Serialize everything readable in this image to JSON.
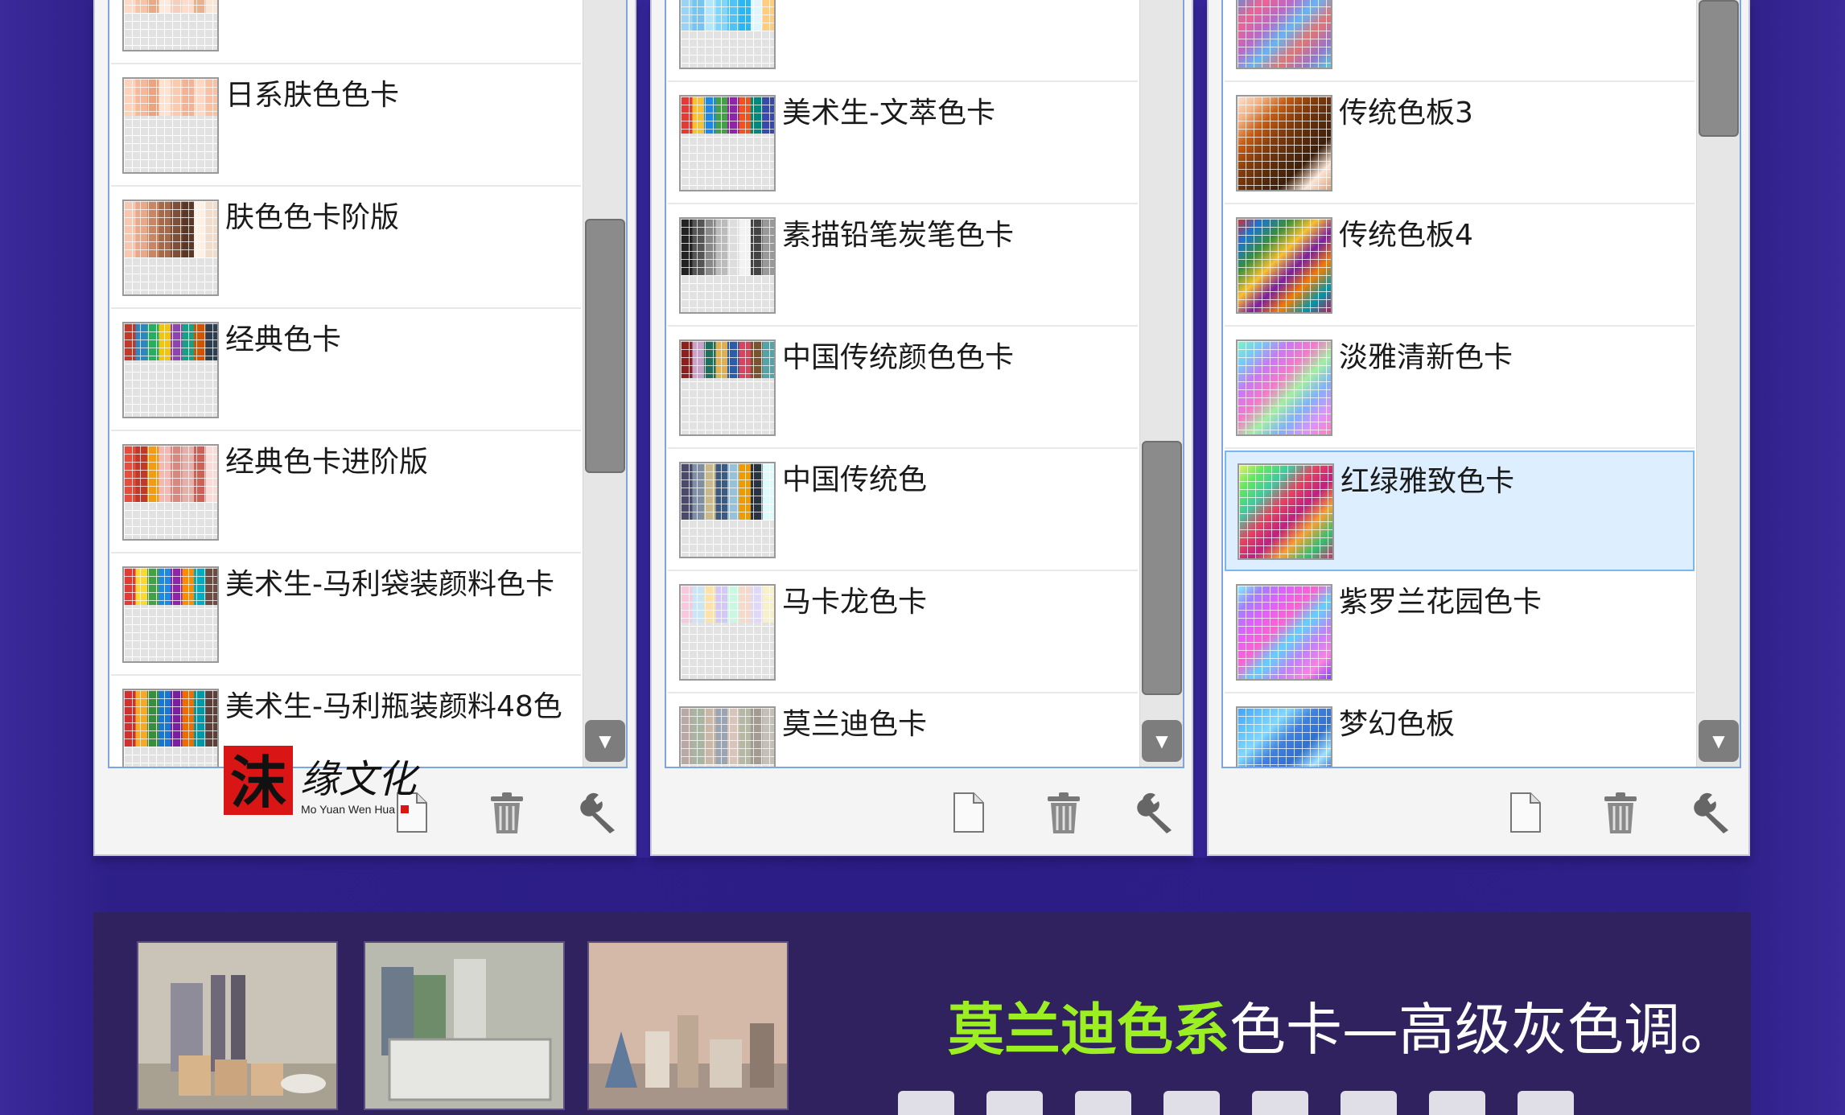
{
  "panels": [
    {
      "items": [
        {
          "label": "",
          "colors": [
            "#ffd9c8",
            "#f6c3a6",
            "#e9a983",
            "#ffe8dc",
            "#f5cfbb",
            "#ffdcca",
            "#e8b18f",
            "#f9e6d7"
          ]
        },
        {
          "label": "日系肤色色卡",
          "colors": [
            "#ffd1b8",
            "#f7b899",
            "#efa27e",
            "#ffe1cf",
            "#fbc9ad",
            "#f3b293",
            "#ffd7c2",
            "#f9c0a3"
          ]
        },
        {
          "label": "肤色色卡阶版",
          "colors": [
            "#f7c7b0",
            "#e8a98a",
            "#c98663",
            "#a56a49",
            "#7d4f37",
            "#5a3827",
            "#fff0e6",
            "#f2dccb"
          ]
        },
        {
          "label": "经典色卡",
          "colors": [
            "#c0392b",
            "#2e86c1",
            "#27ae60",
            "#f1c40f",
            "#8e44ad",
            "#16a085",
            "#d35400",
            "#2c3e50"
          ]
        },
        {
          "label": "经典色卡进阶版",
          "colors": [
            "#e74c3c",
            "#c0392b",
            "#f39c12",
            "#f5b7b1",
            "#d98880",
            "#e6b0aa",
            "#cd6155",
            "#fadbd8"
          ]
        },
        {
          "label": "美术生-马利袋装颜料色卡",
          "colors": [
            "#e53935",
            "#fdd835",
            "#43a047",
            "#1e88e5",
            "#8e24aa",
            "#fb8c00",
            "#00acc1",
            "#6d4c41"
          ]
        },
        {
          "label": "美术生-马利瓶装颜料48色",
          "colors": [
            "#d32f2f",
            "#f9a825",
            "#388e3c",
            "#1976d2",
            "#7b1fa2",
            "#ef6c00",
            "#0097a7",
            "#5d4037"
          ]
        }
      ],
      "scroll_thumb_pos": 0.14
    },
    {
      "items": [
        {
          "label": "",
          "colors": [
            "#9bd3f7",
            "#77c4f0",
            "#b3e5fc",
            "#81d4fa",
            "#4fc3f7",
            "#29b6f6",
            "#e1f5fe",
            "#ffcc80"
          ]
        },
        {
          "label": "美术生-文萃色卡",
          "colors": [
            "#e53935",
            "#fbc02d",
            "#1e88e5",
            "#43a047",
            "#8e24aa",
            "#f4511e",
            "#00897b",
            "#3949ab"
          ]
        },
        {
          "label": "素描铅笔炭笔色卡",
          "colors": [
            "#222222",
            "#555555",
            "#888888",
            "#bbbbbb",
            "#dddddd",
            "#f2f2f2",
            "#444444",
            "#999999"
          ]
        },
        {
          "label": "中国传统颜色色卡",
          "colors": [
            "#8d1f1f",
            "#c8a2c8",
            "#1e6f5c",
            "#e0b050",
            "#2a5caa",
            "#d8435e",
            "#7a5230",
            "#56a3a6"
          ]
        },
        {
          "label": "中国传统色",
          "colors": [
            "#4a4a6a",
            "#7f8fa6",
            "#c8b88a",
            "#3d5a80",
            "#98c1d9",
            "#ee9b00",
            "#293241",
            "#e0fbfc"
          ]
        },
        {
          "label": "马卡龙色卡",
          "colors": [
            "#f8c8dc",
            "#c8e6f8",
            "#fce1a8",
            "#d4c8f8",
            "#c8f8e0",
            "#f8d8c8",
            "#e0d8f8",
            "#f8f0c8"
          ]
        },
        {
          "label": "莫兰迪色卡",
          "colors": [
            "#b8a9a5",
            "#a8b5a2",
            "#c9b7a7",
            "#9aa5b1",
            "#d7c4bb",
            "#b5b8a3",
            "#a39b91",
            "#c4c0b8"
          ]
        }
      ],
      "scroll_thumb_pos": 0.38
    },
    {
      "items": [
        {
          "label": "",
          "colors": [
            "#4fc3f7",
            "#7986cb",
            "#f06292",
            "#ba68c8",
            "#64b5f6",
            "#e57373",
            "#9575cd",
            "#4dd0e1"
          ]
        },
        {
          "label": "传统色板3",
          "colors": [
            "#fce4d6",
            "#f4b183",
            "#c55a11",
            "#843c0c",
            "#5a2d0c",
            "#3b1f0a",
            "#fbe5d6",
            "#d9a07a"
          ]
        },
        {
          "label": "传统色板4",
          "colors": [
            "#d32f2f",
            "#1976d2",
            "#388e3c",
            "#fbc02d",
            "#7b1fa2",
            "#f57c00",
            "#0097a7",
            "#c2185b"
          ]
        },
        {
          "label": "淡雅清新色卡",
          "colors": [
            "#7cf8c0",
            "#78c8f8",
            "#c878f8",
            "#f878c8",
            "#a0f0a0",
            "#80b0ff",
            "#e090ff",
            "#ff80b0"
          ]
        },
        {
          "label": "红绿雅致色卡",
          "colors": [
            "#e8f060",
            "#60e860",
            "#40c8a0",
            "#e84060",
            "#c02080",
            "#f8a030",
            "#30c070",
            "#d03070"
          ],
          "selected": true
        },
        {
          "label": "紫罗兰花园色卡",
          "colors": [
            "#80f8ff",
            "#a080ff",
            "#e060ff",
            "#ff60d0",
            "#60d0ff",
            "#c080ff",
            "#ff80e0",
            "#8040ff"
          ]
        },
        {
          "label": "梦幻色板",
          "colors": [
            "#40a0ff",
            "#60c0ff",
            "#80d8ff",
            "#4080e0",
            "#3070d0",
            "#a0e0ff",
            "#2060c0",
            "#70b0f0"
          ]
        }
      ],
      "scroll_thumb_pos": 0.0
    }
  ],
  "toolbar": {
    "new_icon": "new-document-icon",
    "delete_icon": "trash-icon",
    "settings_icon": "wrench-icon"
  },
  "logo": {
    "seal_char": "沫",
    "script_text": "缘文化",
    "subtitle": "Mo Yuan Wen Hua",
    "seal_color": "#d91515"
  },
  "caption": {
    "highlight": "莫兰迪色系",
    "rest": "色卡—高级灰色调。",
    "highlight_color": "#9cf022"
  },
  "colors": {
    "background": "#2b1c86",
    "accent_border": "#7ea5e2",
    "selection": "#dceeff"
  }
}
